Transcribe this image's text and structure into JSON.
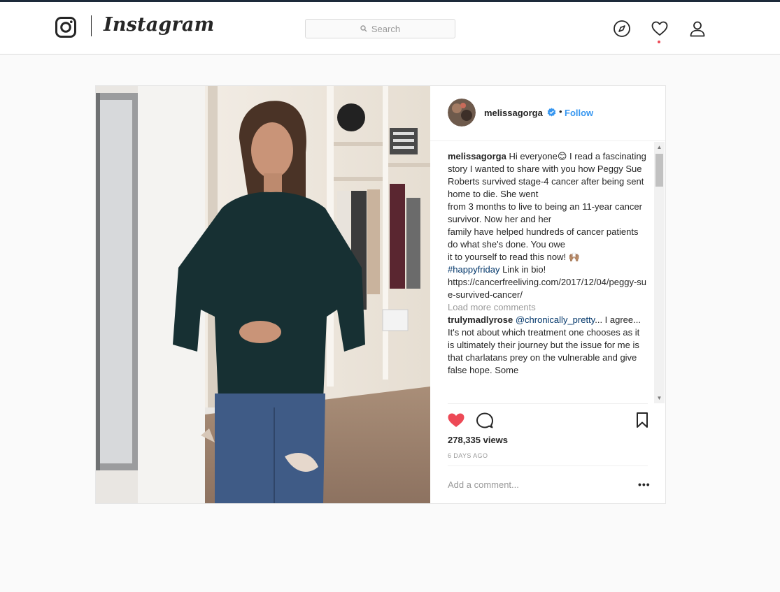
{
  "header": {
    "brand": "Instagram",
    "search_placeholder": "Search",
    "icons": [
      "instagram-logo-icon",
      "search-icon",
      "compass-icon",
      "heart-icon",
      "profile-icon"
    ]
  },
  "post": {
    "author": "melissagorga",
    "verified": true,
    "follow_label": "Follow",
    "separator": "•",
    "caption": {
      "author": "melissagorga",
      "lines": [
        "Hi everyone😊 I read a fascinating story I wanted to share with you how Peggy Sue",
        "Roberts survived stage-4 cancer after being sent home to die. She went",
        "from 3 months to live to being an 11-year cancer survivor. Now her and her",
        "family have helped hundreds of cancer patients do what she's done. You owe",
        "it to yourself to read this now! 🙌🏽"
      ],
      "hashtag": "#happyfriday",
      "after_hashtag": " Link in bio!",
      "url": "https://cancerfreeliving.com/2017/12/04/peggy-sue-survived-cancer/"
    },
    "load_more": "Load more comments",
    "comments": [
      {
        "author": "trulymadlyrose",
        "mention": "@chronically_pretty",
        "text": "... I agree... It's not about which treatment one chooses as it is ultimately their journey but the issue for me is that charlatans prey on the vulnerable and give false hope. Some"
      }
    ],
    "views": "278,335 views",
    "timestamp": "6 DAYS AGO",
    "add_comment_placeholder": "Add a comment...",
    "more_label": "•••"
  },
  "colors": {
    "accent": "#3897f0",
    "like": "#ed4956",
    "verified": "#3897f0"
  }
}
